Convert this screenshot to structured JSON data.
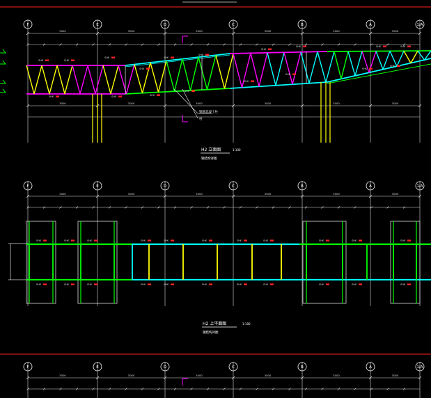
{
  "colors": {
    "background": "#000000",
    "border": "#ff2020",
    "grid": "#ffffff",
    "dim": "#e6e6e6",
    "magenta": "#ff00ff",
    "yellow": "#ffff00",
    "cyan": "#00ffff",
    "green": "#00ff00",
    "red": "#ff2020"
  },
  "grid_axes": [
    "F",
    "E",
    "D",
    "C",
    "B",
    "A",
    "1/A"
  ],
  "elevation": {
    "title": "H2 立面图",
    "scale": "1:100",
    "subtitle": "钢结构详图",
    "leader_note_1": "钢筋混凝土柱",
    "leader_note_2": "柱",
    "section_mark": "1",
    "top_dims": [
      "3000",
      "3000",
      "3000",
      "3000",
      "3000",
      "3000"
    ],
    "bottom_dims": [
      "3000",
      "3000",
      "3000",
      "3000",
      "3000",
      "3000"
    ],
    "member_label": "SHK"
  },
  "plan": {
    "title": "H2 上平面图",
    "scale": "1:100",
    "subtitle": "钢结构详图",
    "top_dims": [
      "3000",
      "3000",
      "3000",
      "3000",
      "3000",
      "3000"
    ],
    "member_label": "SHK"
  }
}
